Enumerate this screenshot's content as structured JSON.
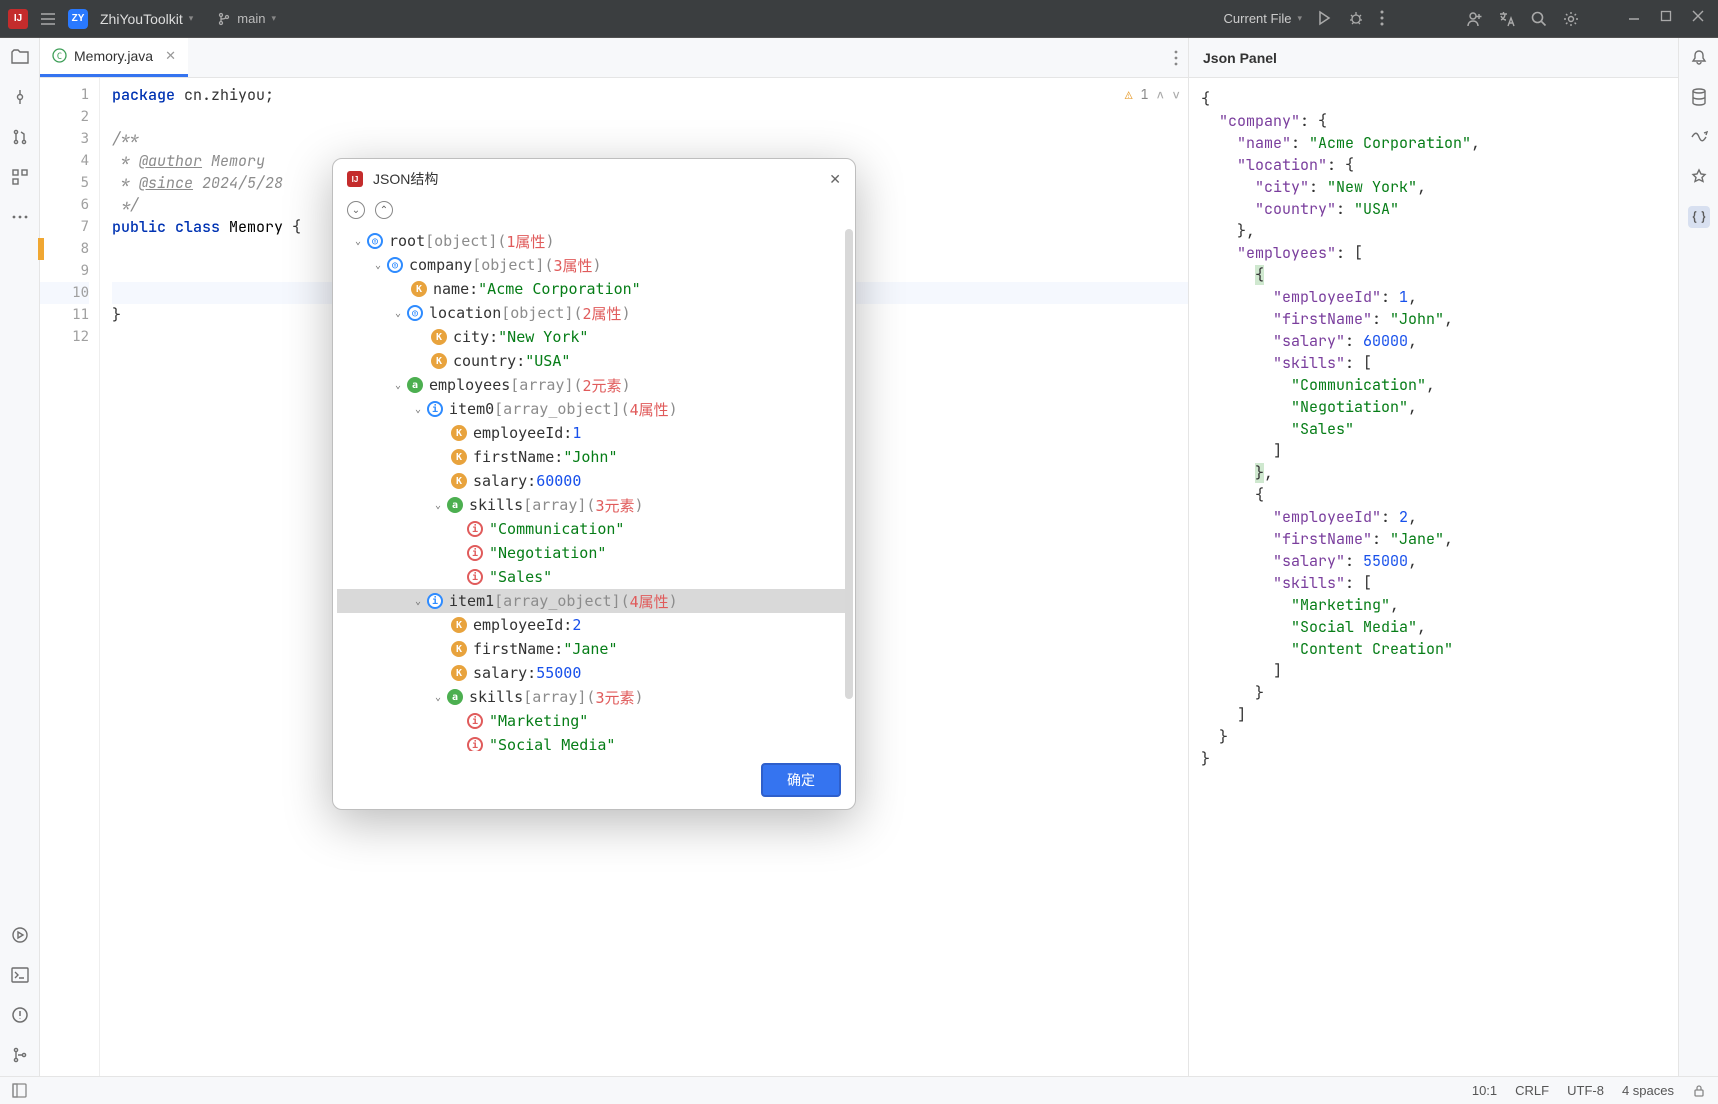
{
  "titlebar": {
    "project_badge": "ZY",
    "project_name": "ZhiYouToolkit",
    "branch": "main",
    "run_target": "Current File"
  },
  "tabs": {
    "active_file": "Memory.java"
  },
  "code": {
    "lines": {
      "l1": "package cn.zhiyou;",
      "l3": "/**",
      "l4_a": " * ",
      "l4_b": "@author",
      "l4_c": " Memory",
      "l5_a": " * ",
      "l5_b": "@since",
      "l5_c": " 2024/5/28",
      "l6": " */",
      "l7": "public class Memory {",
      "l11": "}"
    },
    "gutter": [
      "1",
      "2",
      "3",
      "4",
      "5",
      "6",
      "7",
      "8",
      "9",
      "10",
      "11",
      "12"
    ]
  },
  "inspection": {
    "warn_count": "1"
  },
  "right_panel": {
    "title": "Json Panel"
  },
  "json_data": {
    "company": {
      "name": "Acme Corporation",
      "location": {
        "city": "New York",
        "country": "USA"
      },
      "employees": [
        {
          "employeeId": 1,
          "firstName": "John",
          "salary": 60000,
          "skills": [
            "Communication",
            "Negotiation",
            "Sales"
          ]
        },
        {
          "employeeId": 2,
          "firstName": "Jane",
          "salary": 55000,
          "skills": [
            "Marketing",
            "Social Media",
            "Content Creation"
          ]
        }
      ]
    }
  },
  "dialog": {
    "title": "JSON结构",
    "ok_label": "确定",
    "labels": {
      "root": "root",
      "object": "[object]",
      "array": "[array]",
      "array_object": "[array_object]",
      "attr1": "1属性",
      "attr2": "2属性",
      "attr3": "3属性",
      "attr4": "4属性",
      "elem2": "2元素",
      "elem3": "3元素"
    },
    "nodes": {
      "company": "company",
      "name": "name:",
      "name_v": "\"Acme Corporation\"",
      "location": "location",
      "city": "city:",
      "city_v": "\"New York\"",
      "country": "country:",
      "country_v": "\"USA\"",
      "employees": "employees",
      "item0": "item0",
      "item1": "item1",
      "employeeId": "employeeId:",
      "eid0": "1",
      "eid1": "2",
      "firstName": "firstName:",
      "fn0": "\"John\"",
      "fn1": "\"Jane\"",
      "salary": "salary:",
      "sal0": "60000",
      "sal1": "55000",
      "skills": "skills",
      "sk_comm": "\"Communication\"",
      "sk_neg": "\"Negotiation\"",
      "sk_sales": "\"Sales\"",
      "sk_mkt": "\"Marketing\"",
      "sk_soc": "\"Social Media\""
    }
  },
  "status": {
    "pos": "10:1",
    "eol": "CRLF",
    "enc": "UTF-8",
    "indent": "4 spaces"
  },
  "chart_data": {
    "type": "table",
    "title": "company",
    "note": "JSON tree structure displayed in dialog — same as json_data"
  }
}
